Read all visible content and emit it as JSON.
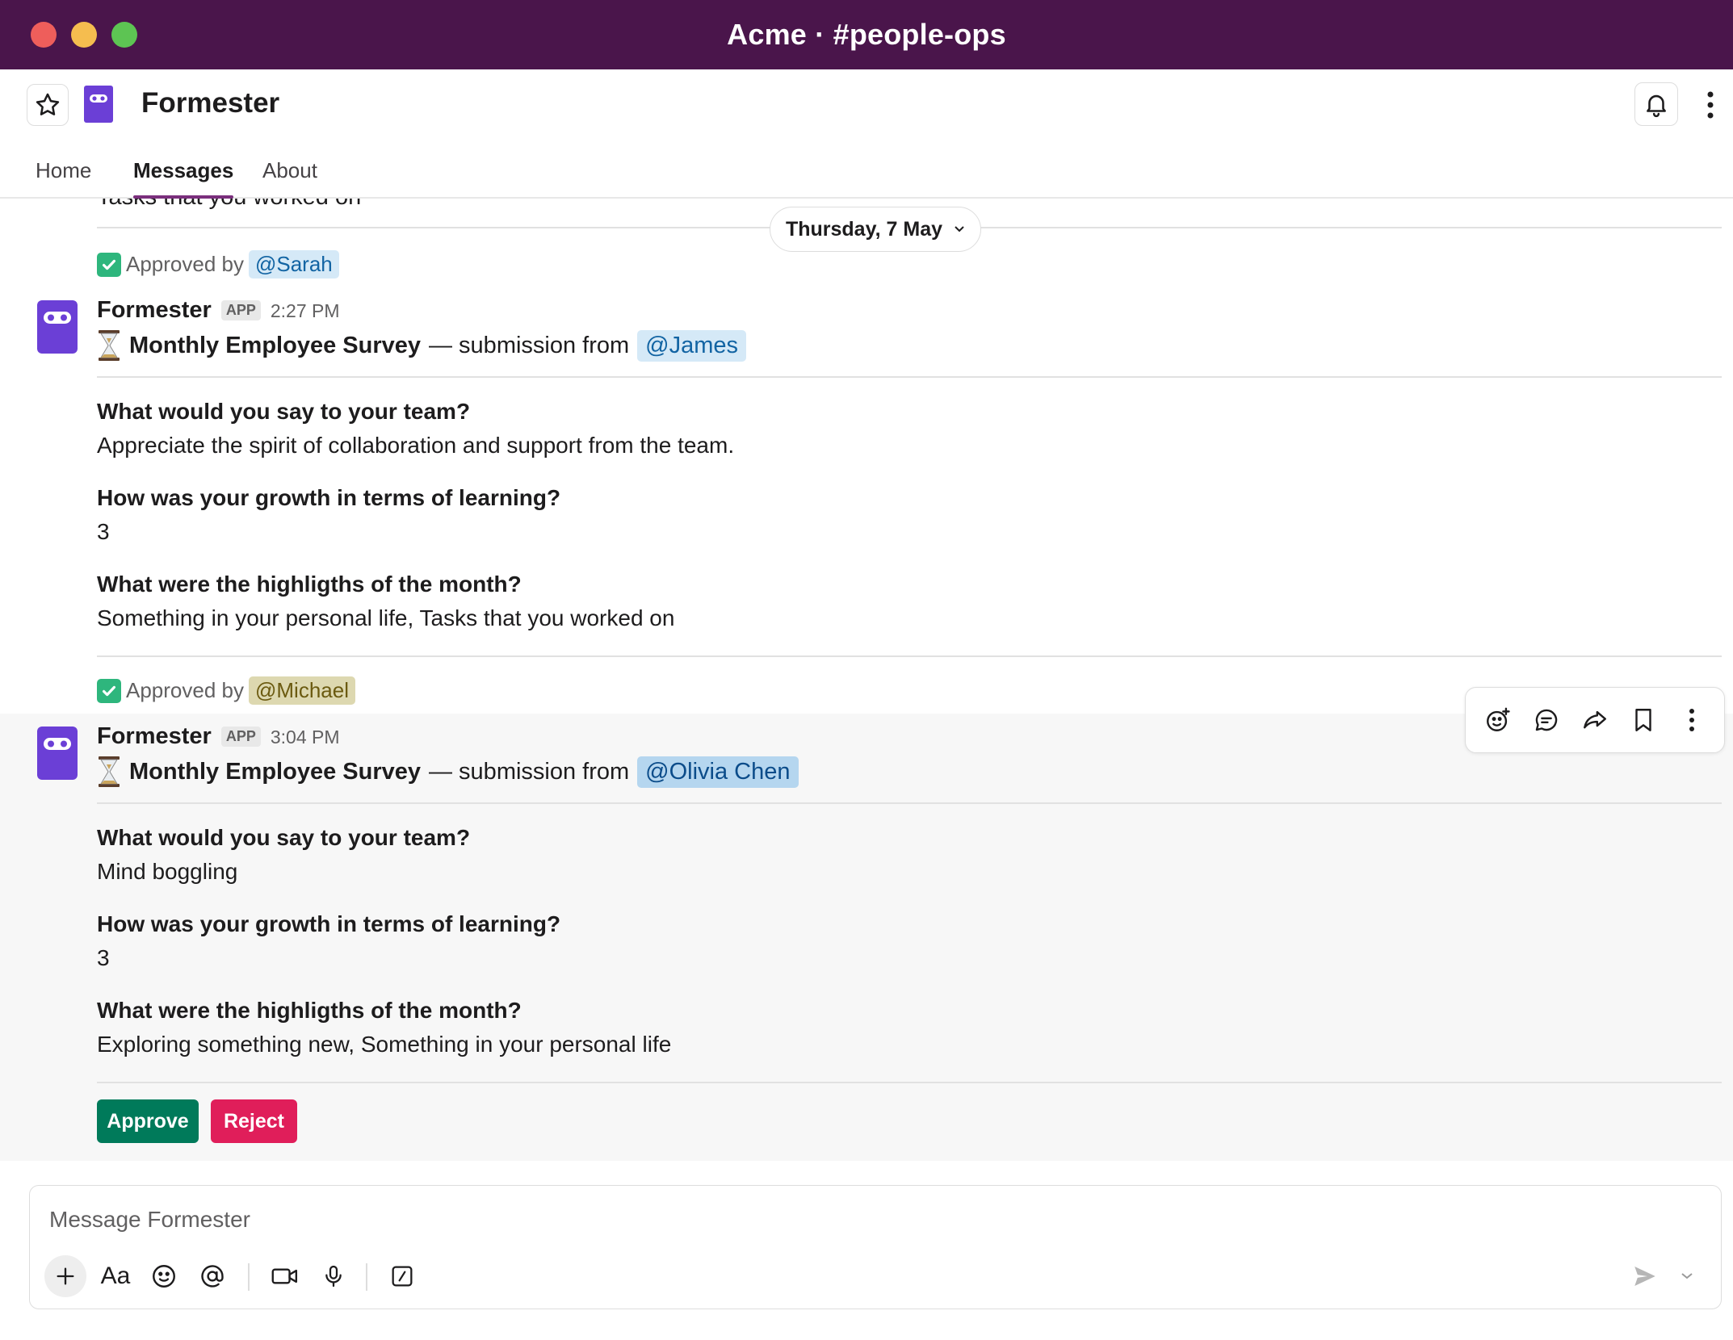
{
  "window": {
    "title": "Acme · #people-ops"
  },
  "app": {
    "name": "Formester"
  },
  "tabs": [
    {
      "label": "Home"
    },
    {
      "label": "Messages"
    },
    {
      "label": "About"
    }
  ],
  "messages_area": {
    "clipped_text": "Tasks that you worked on",
    "date_divider": "Thursday, 7 May",
    "approved_prefix": "Approved by",
    "first_approval_user": "@Sarah",
    "second_approval_user": "@Michael",
    "items": [
      {
        "sender": "Formester",
        "badge": "APP",
        "time": "2:27 PM",
        "survey_title": "Monthly Employee Survey",
        "submission_text": "— submission from",
        "submitter": "@James",
        "qa": [
          {
            "q": "What would you say to your team?",
            "a": "Appreciate the spirit of collaboration and support from the team."
          },
          {
            "q": "How was your growth in terms of learning?",
            "a": "3"
          },
          {
            "q": "What were the highligths of the month?",
            "a": "Something in your personal life, Tasks that you worked on"
          }
        ]
      },
      {
        "sender": "Formester",
        "badge": "APP",
        "time": "3:04 PM",
        "survey_title": "Monthly Employee Survey",
        "submission_text": "— submission from",
        "submitter": "@Olivia Chen",
        "qa": [
          {
            "q": "What would you say to your team?",
            "a": "Mind boggling"
          },
          {
            "q": "How was your growth in terms of learning?",
            "a": "3"
          },
          {
            "q": "What were the highligths of the month?",
            "a": "Exploring something new, Something in your personal life"
          }
        ],
        "actions": {
          "approve": "Approve",
          "reject": "Reject"
        }
      }
    ]
  },
  "composer": {
    "placeholder": "Message Formester",
    "format_label": "Aa"
  },
  "colors": {
    "titlebar": "#4a154b",
    "app_purple": "#6b3fd6",
    "approve_green": "#007a5a",
    "reject_red": "#e01e5a",
    "mention_blue": "#1264a3"
  }
}
